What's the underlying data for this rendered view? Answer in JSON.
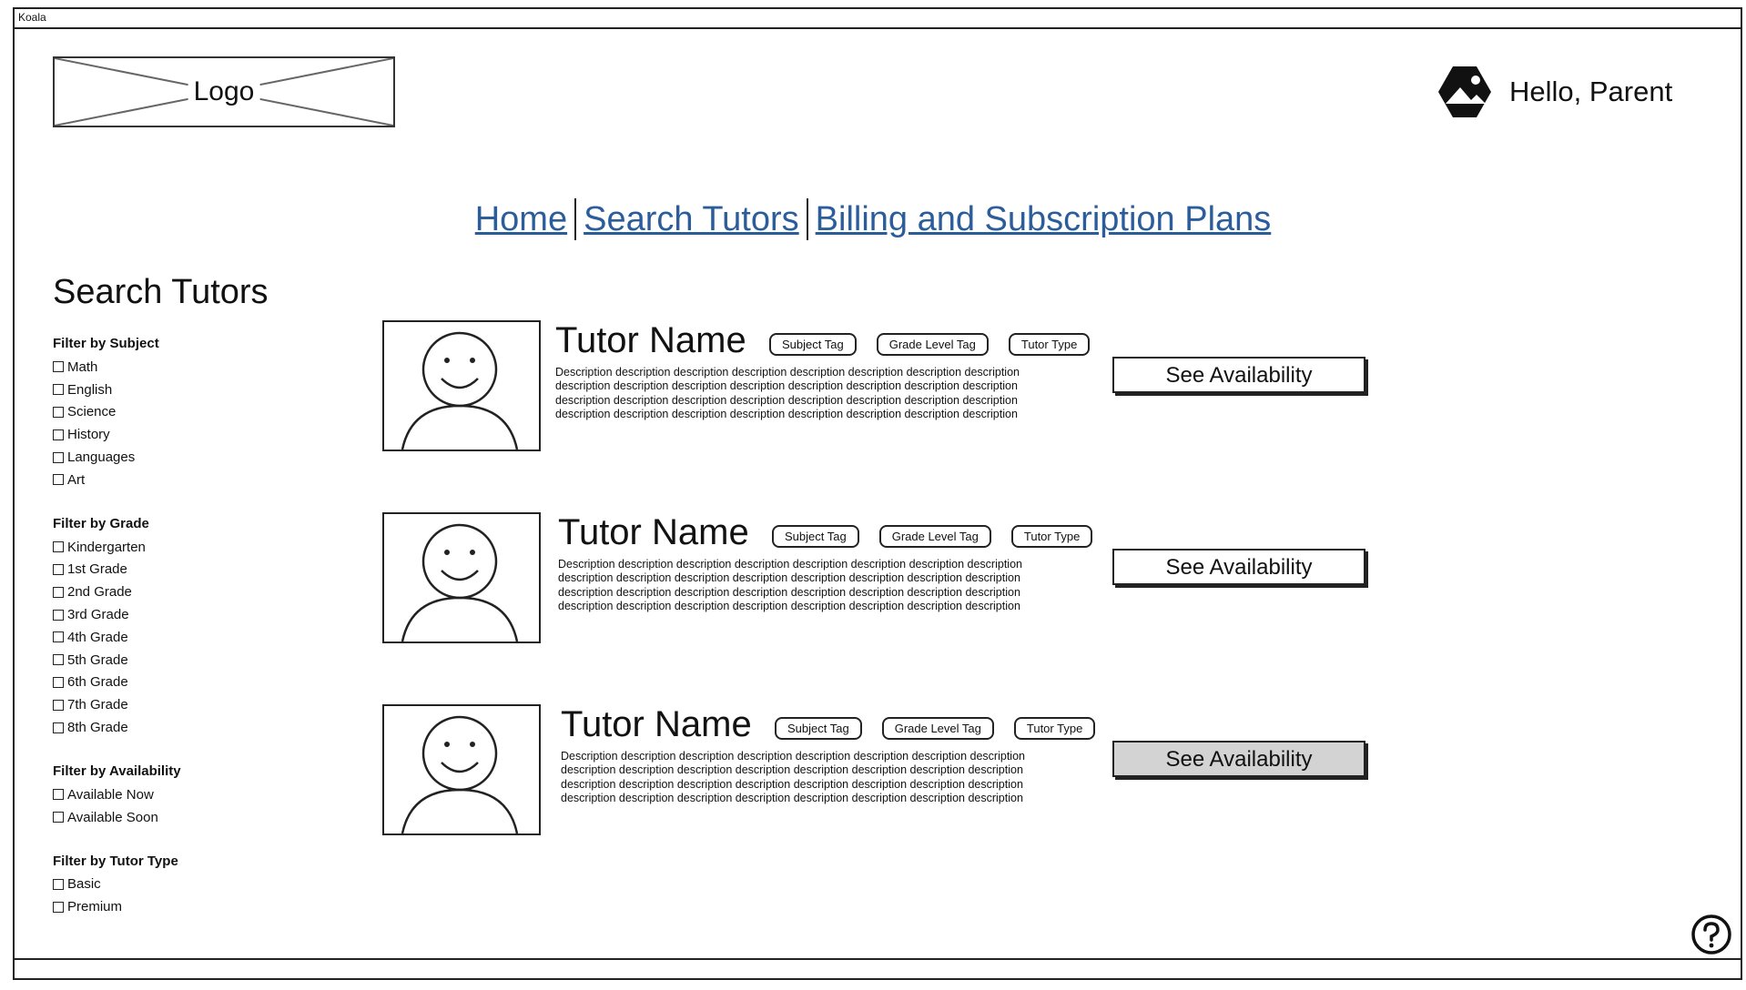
{
  "window": {
    "title": "Koala"
  },
  "logo": {
    "label": "Logo"
  },
  "user": {
    "icon": "avatar-icon",
    "greeting": "Hello, Parent"
  },
  "nav": {
    "items": [
      {
        "label": "Home"
      },
      {
        "label": "Search Tutors"
      },
      {
        "label": "Billing and Subscription Plans"
      }
    ],
    "link_color": "#2a5d9a"
  },
  "sidebar": {
    "title": "Search Tutors",
    "filters": {
      "subject": {
        "title": "Filter by Subject",
        "options": [
          "Math",
          "English",
          "Science",
          "History",
          "Languages",
          "Art"
        ]
      },
      "grade": {
        "title": "Filter by Grade",
        "options": [
          "Kindergarten",
          "1st Grade",
          "2nd Grade",
          "3rd Grade",
          "4th Grade",
          "5th Grade",
          "6th Grade",
          "7th Grade",
          "8th Grade"
        ]
      },
      "availability": {
        "title": "Filter by Availability",
        "options": [
          "Available Now",
          "Available Soon"
        ]
      },
      "tutor_type": {
        "title": "Filter by Tutor Type",
        "options": [
          "Basic",
          "Premium"
        ]
      }
    }
  },
  "tutors": [
    {
      "name": "Tutor Name",
      "tags": [
        "Subject Tag",
        "Grade Level Tag",
        "Tutor Type"
      ],
      "description": "Description description description description description description description description description description description description description description description description description description description description description description description description description description description description description description description description",
      "button": "See Availability"
    },
    {
      "name": "Tutor Name",
      "tags": [
        "Subject Tag",
        "Grade Level Tag",
        "Tutor Type"
      ],
      "description": "Description description description description description description description description description description description description description description description description description description description description description description description description description description description description description description description description",
      "button": "See Availability"
    },
    {
      "name": "Tutor Name",
      "tags": [
        "Subject Tag",
        "Grade Level Tag",
        "Tutor Type"
      ],
      "description": "Description description description description description description description description description description description description description description description description description description description description description description description description description description description description description description description description",
      "button": "See Availability"
    }
  ],
  "help": {
    "icon": "help-icon"
  },
  "colors": {
    "hover_button": "#d3d3d3"
  }
}
